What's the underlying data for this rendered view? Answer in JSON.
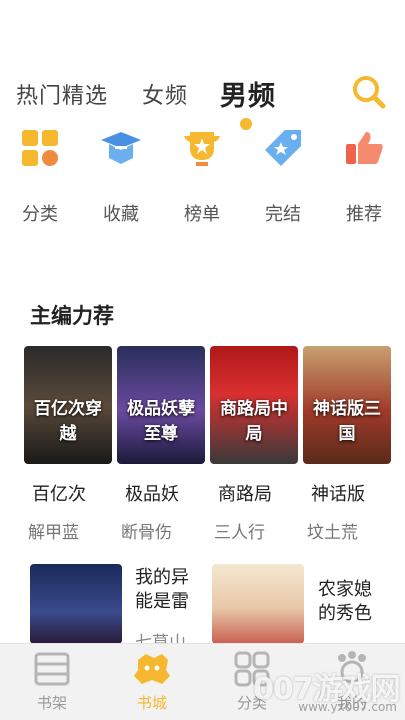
{
  "header": {
    "tabs": [
      {
        "label": "热门精选"
      },
      {
        "label": "女频"
      },
      {
        "label": "男频"
      }
    ],
    "active_tab": "男频",
    "search_icon": "search-icon"
  },
  "categories": [
    {
      "label": "分类",
      "icon": "grid-icon"
    },
    {
      "label": "收藏",
      "icon": "graduation-cap-icon"
    },
    {
      "label": "榜单",
      "icon": "trophy-icon"
    },
    {
      "label": "完结",
      "icon": "tag-icon"
    },
    {
      "label": "推荐",
      "icon": "thumbs-up-icon"
    }
  ],
  "recommend": {
    "title": "主编力荐",
    "books": [
      {
        "title": "百亿次",
        "author": "解甲蓝",
        "cover_text": "百亿次穿越"
      },
      {
        "title": "极品妖",
        "author": "断骨伤",
        "cover_text": "极品妖孽至尊"
      },
      {
        "title": "商路局",
        "author": "三人行",
        "cover_text": "商路局中局"
      },
      {
        "title": "神话版",
        "author": "坟土荒",
        "cover_text": "神话版三国"
      }
    ]
  },
  "row2": [
    {
      "title": "我的异能是雷",
      "author": "七草山"
    },
    {
      "title": "农家媳的秀色",
      "author": ""
    }
  ],
  "bottom_nav": [
    {
      "label": "书架",
      "icon": "bookshelf-icon"
    },
    {
      "label": "书城",
      "icon": "bookstore-icon"
    },
    {
      "label": "分类",
      "icon": "category-icon"
    },
    {
      "label": "我的",
      "icon": "profile-icon"
    }
  ],
  "watermark": {
    "text": "007游戏网",
    "url": "www.yx007.com"
  },
  "colors": {
    "accent": "#f5b82e",
    "blue": "#4a90e2",
    "red": "#f0634a"
  }
}
